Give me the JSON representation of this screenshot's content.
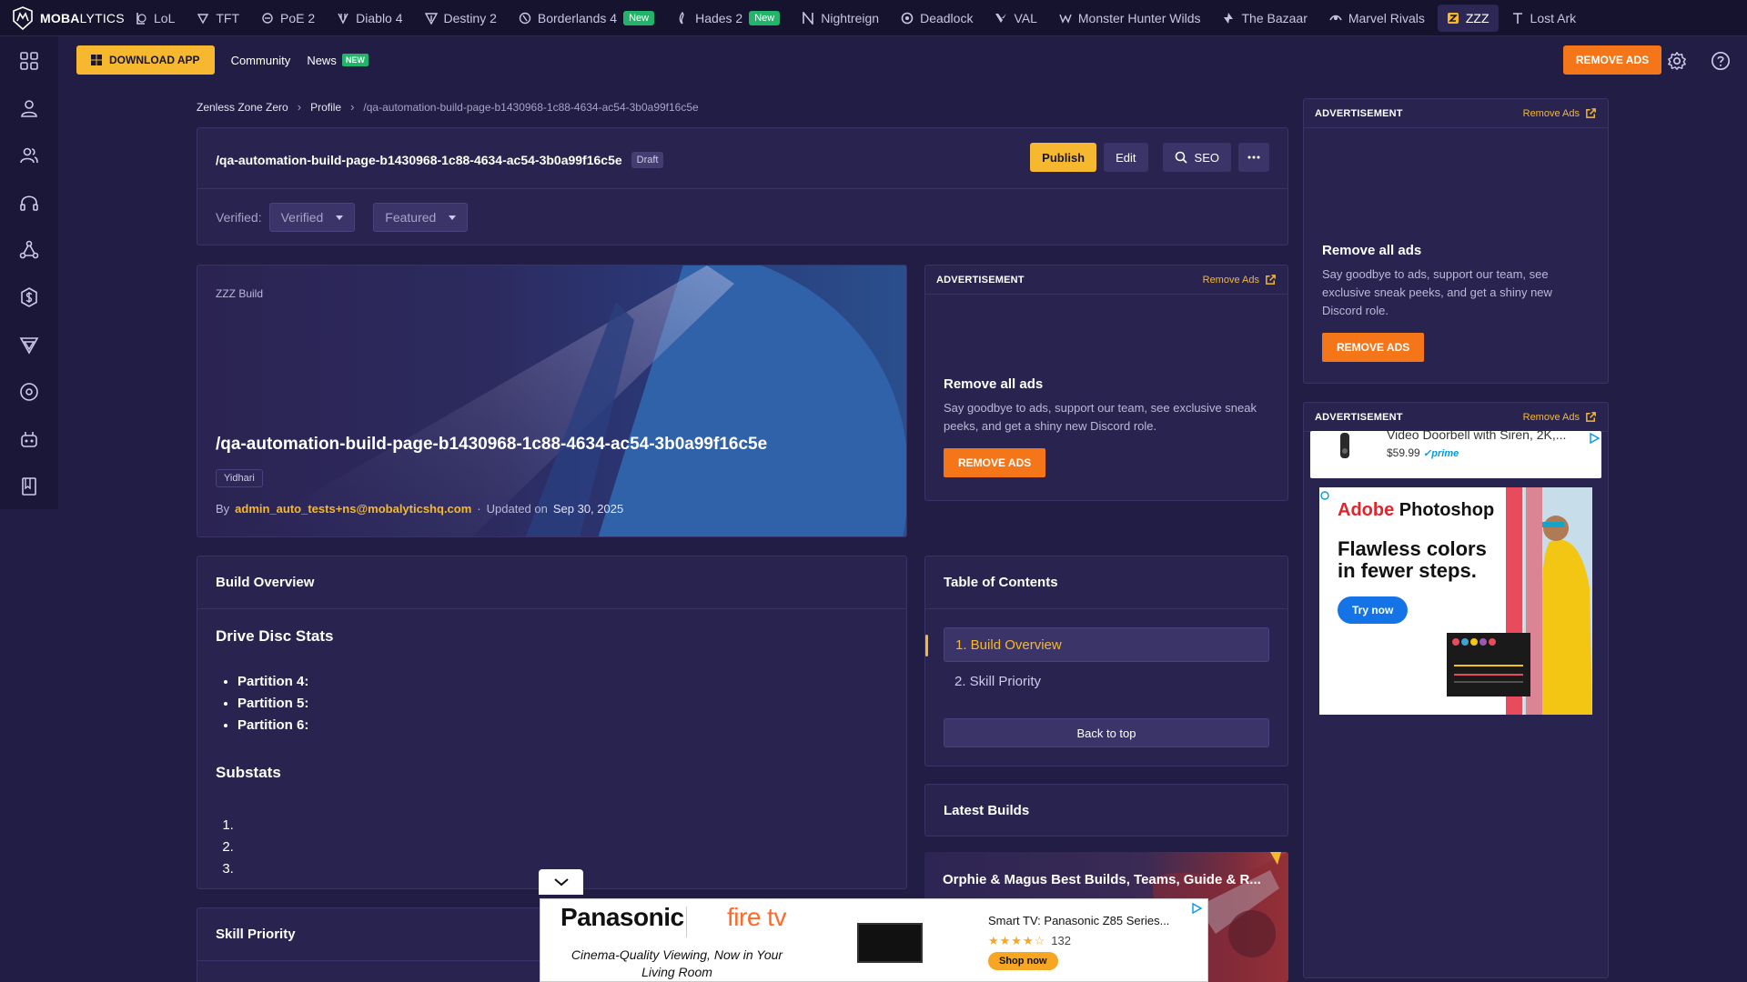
{
  "topnav": {
    "logo_bold": "MOBA",
    "logo_thin": "LYTICS",
    "games": [
      {
        "label": "LoL",
        "icon": "lol-icon",
        "badge": ""
      },
      {
        "label": "TFT",
        "icon": "tft-icon",
        "badge": ""
      },
      {
        "label": "PoE 2",
        "icon": "poe2-icon",
        "badge": ""
      },
      {
        "label": "Diablo 4",
        "icon": "diablo4-icon",
        "badge": ""
      },
      {
        "label": "Destiny 2",
        "icon": "destiny2-icon",
        "badge": ""
      },
      {
        "label": "Borderlands 4",
        "icon": "borderlands4-icon",
        "badge": "New"
      },
      {
        "label": "Hades 2",
        "icon": "hades2-icon",
        "badge": "New"
      },
      {
        "label": "Nightreign",
        "icon": "nightreign-icon",
        "badge": ""
      },
      {
        "label": "Deadlock",
        "icon": "deadlock-icon",
        "badge": ""
      },
      {
        "label": "VAL",
        "icon": "valorant-icon",
        "badge": ""
      },
      {
        "label": "Monster Hunter Wilds",
        "icon": "mhw-icon",
        "badge": ""
      },
      {
        "label": "The Bazaar",
        "icon": "bazaar-icon",
        "badge": ""
      },
      {
        "label": "Marvel Rivals",
        "icon": "marvel-rivals-icon",
        "badge": ""
      },
      {
        "label": "ZZZ",
        "icon": "zzz-icon",
        "badge": "",
        "active": true
      },
      {
        "label": "Lost Ark",
        "icon": "lost-ark-icon",
        "badge": ""
      }
    ]
  },
  "sidebar": {
    "icons": [
      "grid-icon",
      "profile-icon",
      "friends-icon",
      "headset-icon",
      "network-icon",
      "currency-icon",
      "triangle-icon",
      "disc-icon",
      "robot-icon",
      "book-icon"
    ]
  },
  "subnav": {
    "download_label": "DOWNLOAD APP",
    "community_label": "Community",
    "news_label": "News",
    "news_badge": "NEW",
    "remove_ads_label": "REMOVE ADS"
  },
  "breadcrumb": {
    "items": [
      "Zenless Zone Zero",
      "Profile"
    ],
    "current": "/qa-automation-build-page-b1430968-1c88-4634-ac54-3b0a99f16c5e"
  },
  "header": {
    "title": "/qa-automation-build-page-b1430968-1c88-4634-ac54-3b0a99f16c5e",
    "status": "Draft",
    "publish_label": "Publish",
    "edit_label": "Edit",
    "seo_label": "SEO",
    "verified_label": "Verified:",
    "verified_value": "Verified",
    "featured_value": "Featured"
  },
  "hero": {
    "tag": "ZZZ Build",
    "title": "/qa-automation-build-page-b1430968-1c88-4634-ac54-3b0a99f16c5e",
    "chip": "Yidhari",
    "by_label": "By",
    "author": "admin_auto_tests+ns@mobalyticshq.com",
    "dot": "·",
    "updated_label": "Updated on",
    "updated_date": "Sep 30, 2025"
  },
  "ad_mid": {
    "label": "ADVERTISEMENT",
    "remove_link": "Remove Ads",
    "heading": "Remove all ads",
    "text": "Say goodbye to ads, support our team, see exclusive sneak peeks, and get a shiny new Discord role.",
    "button": "REMOVE ADS"
  },
  "ad_right1": {
    "label": "ADVERTISEMENT",
    "remove_link": "Remove Ads",
    "heading": "Remove all ads",
    "text": "Say goodbye to ads, support our team, see exclusive sneak peeks, and get a shiny new Discord role.",
    "button": "REMOVE ADS"
  },
  "ad_right2": {
    "label": "ADVERTISEMENT",
    "remove_link": "Remove Ads",
    "amazon_title": "Video Doorbell with Siren, 2K,...",
    "amazon_price": "$59.99",
    "amazon_prime": "✓prime",
    "adobe_brand_a": "Adobe",
    "adobe_brand_b": "Photoshop",
    "adobe_tagline": "Flawless colors in fewer steps.",
    "adobe_cta": "Try now"
  },
  "build_overview": {
    "title": "Build Overview",
    "drive_disc_heading": "Drive Disc Stats",
    "partitions": [
      "Partition 4:",
      "Partition 5:",
      "Partition 6:"
    ],
    "substats_heading": "Substats",
    "substats": [
      "",
      "",
      ""
    ]
  },
  "toc": {
    "title": "Table of Contents",
    "items": [
      "1. Build Overview",
      "2. Skill Priority"
    ],
    "back_to_top": "Back to top"
  },
  "latest_builds": {
    "title": "Latest Builds",
    "card_title": "Orphie & Magus Best Builds, Teams, Guide & R..."
  },
  "skill_priority": {
    "title": "Skill Priority"
  },
  "bottom_ad": {
    "brand": "Panasonic",
    "partner": "fire tv",
    "tagline": "Cinema-Quality Viewing, Now in Your Living Room",
    "product": "Smart TV: Panasonic Z85 Series...",
    "stars": "★★★★☆",
    "rating_count": "132",
    "shop_label": "Shop now"
  },
  "colors": {
    "accent": "#f5b82e",
    "orange": "#f47618",
    "bg": "#221d45",
    "panel": "#29234f"
  }
}
